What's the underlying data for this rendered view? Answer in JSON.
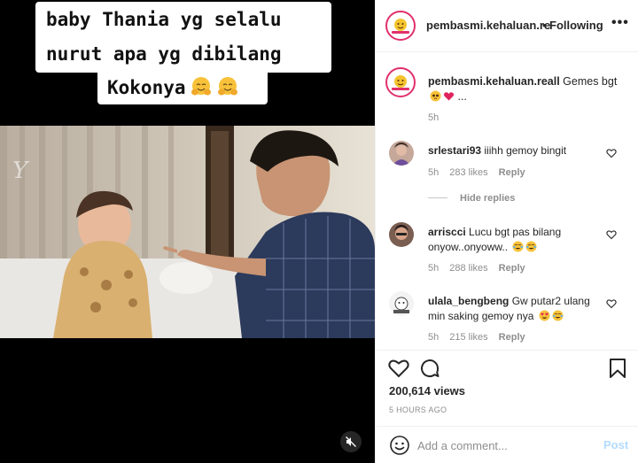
{
  "video": {
    "caption_lines": [
      "baby Thania yg selalu",
      "nurut apa yg dibilang",
      "Kokonya"
    ],
    "caption_emoji": "hugging-face-emoji",
    "watermark_text": "Y"
  },
  "post": {
    "header": {
      "username": "pembasmi.kehaluan.re",
      "separator": "•",
      "follow_status": "Following",
      "more_label": "•••"
    },
    "caption": {
      "username": "pembasmi.kehaluan.reall",
      "text": "Gemes bgt",
      "ellipsis": "...",
      "time": "5h"
    },
    "comments": [
      {
        "username": "srlestari93",
        "text": "iiihh gemoy bingit",
        "time": "5h",
        "likes": "283 likes",
        "reply": "Reply"
      },
      {
        "username": "arriscci",
        "text": "Lucu bgt pas bilang onyow..onyoww..",
        "time": "5h",
        "likes": "288 likes",
        "reply": "Reply"
      },
      {
        "username": "ulala_bengbeng",
        "text": "Gw putar2 ulang min saking gemoy nya",
        "time": "5h",
        "likes": "215 likes",
        "reply": "Reply"
      }
    ],
    "hide_replies": "Hide replies",
    "views": "200,614 views",
    "time_ago": "5 HOURS AGO",
    "add_comment": {
      "placeholder": "Add a comment...",
      "post_label": "Post"
    }
  },
  "colors": {
    "accent_pink": "#e1306c",
    "post_disabled": "#b3dbff",
    "muted_text": "#8e8e8e",
    "text": "#262626"
  }
}
